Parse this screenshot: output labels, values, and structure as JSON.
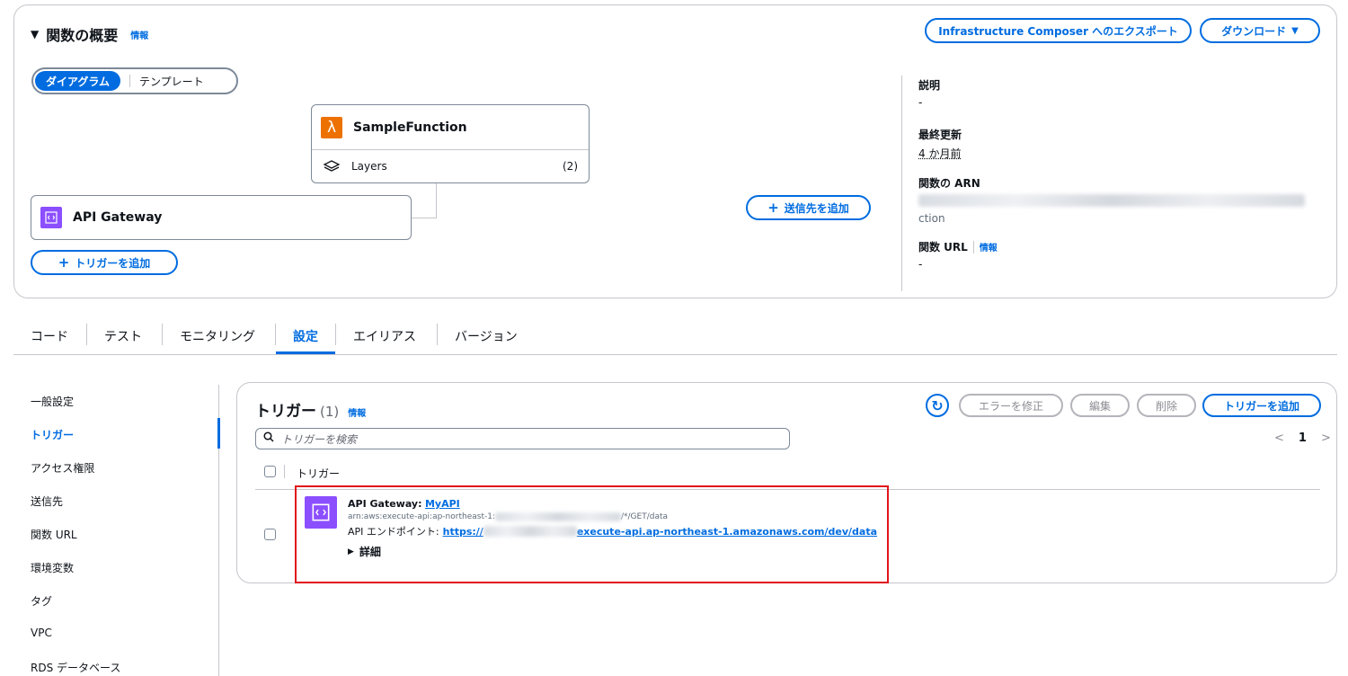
{
  "overview": {
    "title": "関数の概要",
    "info": "情報",
    "export_button": "Infrastructure Composer へのエクスポート",
    "download_button": "ダウンロード",
    "view_toggle": {
      "active": "ダイアグラム",
      "inactive": "テンプレート"
    },
    "function_node": {
      "name": "SampleFunction",
      "layers_label": "Layers",
      "layers_count": "(2)"
    },
    "trigger_node": {
      "name": "API Gateway"
    },
    "add_trigger_button": "トリガーを追加",
    "add_destination_button": "送信先を追加",
    "details": {
      "description_label": "説明",
      "description_value": "-",
      "last_modified_label": "最終更新",
      "last_modified_value": "4 か月前",
      "arn_label": "関数の ARN",
      "arn_tail": "ction",
      "url_label": "関数 URL",
      "url_info": "情報",
      "url_value": "-"
    }
  },
  "tabs": [
    "コード",
    "テスト",
    "モニタリング",
    "設定",
    "エイリアス",
    "バージョン"
  ],
  "active_tab": "設定",
  "side_nav": [
    "一般設定",
    "トリガー",
    "アクセス権限",
    "送信先",
    "関数 URL",
    "環境変数",
    "タグ",
    "VPC",
    "RDS データベース"
  ],
  "active_side_nav": "トリガー",
  "triggers_panel": {
    "title": "トリガー",
    "count": "(1)",
    "info": "情報",
    "buttons": {
      "fix_errors": "エラーを修正",
      "edit": "編集",
      "delete": "削除",
      "add_trigger": "トリガーを追加"
    },
    "search_placeholder": "トリガーを検索",
    "pagination": {
      "page": "1"
    },
    "column_header": "トリガー",
    "rows": [
      {
        "source_label": "API Gateway:",
        "source_link": "MyAPI",
        "arn_prefix": "arn:aws:execute-api:ap-northeast-1:",
        "arn_suffix": "/*/GET/data",
        "endpoint_label": "API エンドポイント:",
        "endpoint_prefix": "https://",
        "endpoint_suffix": "execute-api.ap-northeast-1.amazonaws.com/dev/data",
        "details_toggle": "詳細"
      }
    ]
  },
  "colors": {
    "accent": "#006ce0",
    "highlight_box": "#e0141a",
    "lambda": "#ed7100",
    "api_gateway": "#8c4fff"
  }
}
